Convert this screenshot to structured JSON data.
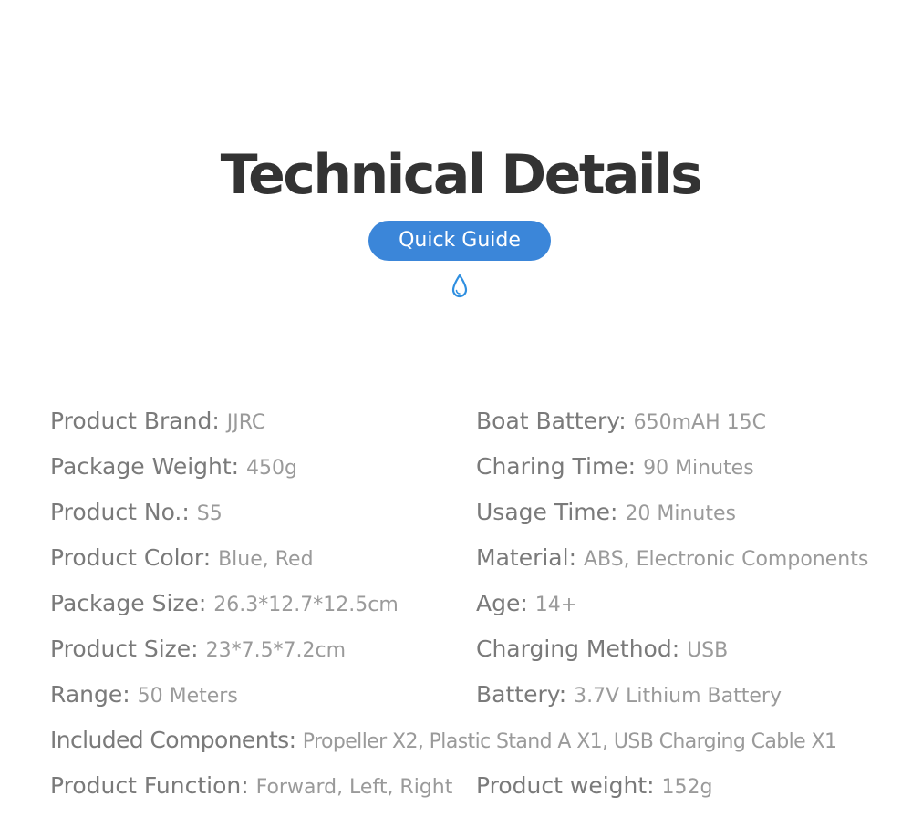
{
  "header": {
    "title": "Technical Details",
    "guide_button": "Quick Guide",
    "divider_icon": "water-drop-icon",
    "accent_color": "#3b86d9"
  },
  "specs": [
    {
      "label": "Product Brand:",
      "value": "JJRC"
    },
    {
      "label": "Boat Battery:",
      "value": "650mAH 15C"
    },
    {
      "label": "Package Weight:",
      "value": "450g"
    },
    {
      "label": "Charing Time:",
      "value": "90 Minutes"
    },
    {
      "label": "Product No.:",
      "value": "S5"
    },
    {
      "label": "Usage Time:",
      "value": "20 Minutes"
    },
    {
      "label": "Product Color:",
      "value": "Blue, Red"
    },
    {
      "label": "Material:",
      "value": "ABS, Electronic Components"
    },
    {
      "label": "Package Size:",
      "value": "26.3*12.7*12.5cm"
    },
    {
      "label": "Age:",
      "value": "14+"
    },
    {
      "label": "Product Size:",
      "value": "23*7.5*7.2cm"
    },
    {
      "label": "Charging Method:",
      "value": "USB"
    },
    {
      "label": "Range:",
      "value": "50 Meters"
    },
    {
      "label": "Battery:",
      "value": "3.7V Lithium Battery"
    },
    {
      "label": "Included Components:",
      "value": "Propeller X2, Plastic Stand A X1, USB Charging Cable X1"
    },
    {
      "label": "Product Function:",
      "value": "Forward, Left, Right"
    },
    {
      "label": "Product weight:",
      "value": "152g"
    }
  ]
}
